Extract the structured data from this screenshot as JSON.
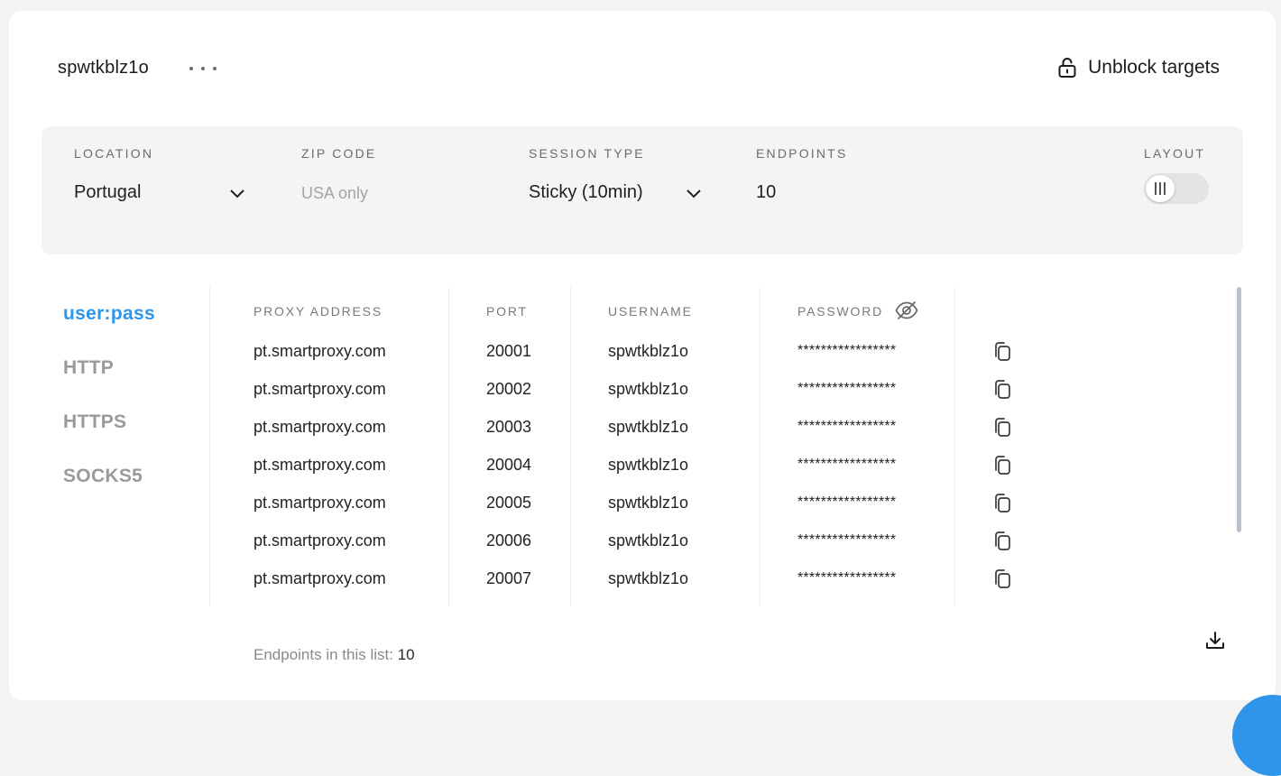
{
  "header": {
    "title": "spwtkblz1o",
    "unblock_label": "Unblock targets"
  },
  "filters": {
    "location": {
      "label": "LOCATION",
      "value": "Portugal"
    },
    "zip": {
      "label": "ZIP CODE",
      "value": "USA only"
    },
    "session": {
      "label": "SESSION TYPE",
      "value": "Sticky (10min)"
    },
    "endpoints": {
      "label": "ENDPOINTS",
      "value": "10"
    },
    "layout": {
      "label": "LAYOUT"
    }
  },
  "sidenav": {
    "items": [
      {
        "label": "user:pass",
        "active": true
      },
      {
        "label": "HTTP",
        "active": false
      },
      {
        "label": "HTTPS",
        "active": false
      },
      {
        "label": "SOCKS5",
        "active": false
      }
    ]
  },
  "table": {
    "headers": {
      "address": "PROXY ADDRESS",
      "port": "PORT",
      "username": "USERNAME",
      "password": "PASSWORD"
    },
    "rows": [
      {
        "address": "pt.smartproxy.com",
        "port": "20001",
        "username": "spwtkblz1o",
        "password": "*****************"
      },
      {
        "address": "pt.smartproxy.com",
        "port": "20002",
        "username": "spwtkblz1o",
        "password": "*****************"
      },
      {
        "address": "pt.smartproxy.com",
        "port": "20003",
        "username": "spwtkblz1o",
        "password": "*****************"
      },
      {
        "address": "pt.smartproxy.com",
        "port": "20004",
        "username": "spwtkblz1o",
        "password": "*****************"
      },
      {
        "address": "pt.smartproxy.com",
        "port": "20005",
        "username": "spwtkblz1o",
        "password": "*****************"
      },
      {
        "address": "pt.smartproxy.com",
        "port": "20006",
        "username": "spwtkblz1o",
        "password": "*****************"
      },
      {
        "address": "pt.smartproxy.com",
        "port": "20007",
        "username": "spwtkblz1o",
        "password": "*****************"
      }
    ]
  },
  "footer": {
    "label": "Endpoints in this list: ",
    "count": "10"
  },
  "colors": {
    "accent": "#2f95ea",
    "panel": "#f4f4f4"
  }
}
